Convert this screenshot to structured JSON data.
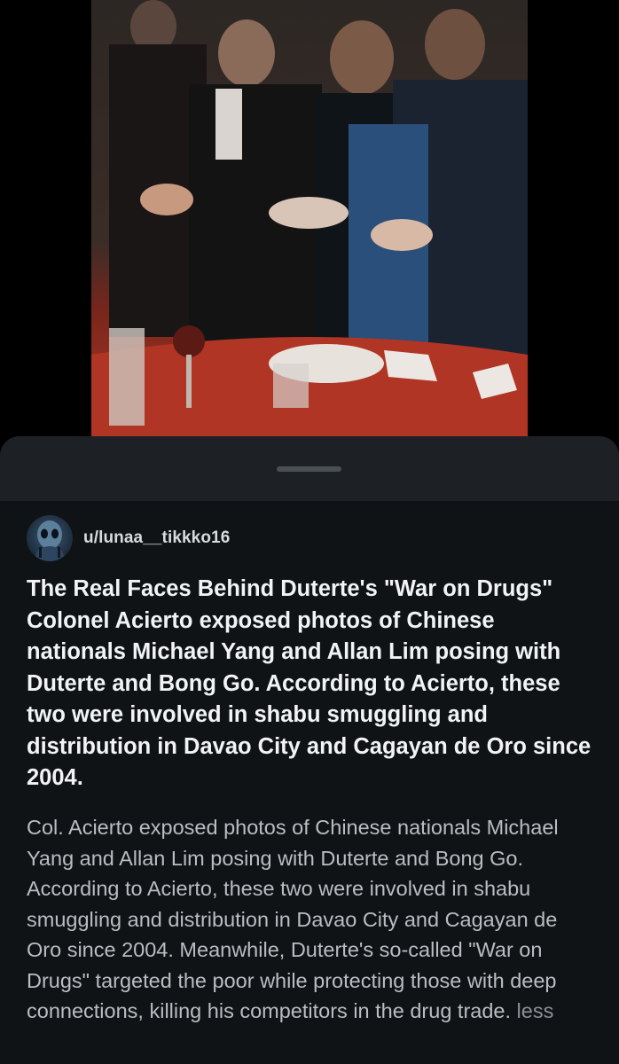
{
  "post": {
    "author": "u/lunaa__tikkko16",
    "avatar_icon": "alien-avatar-icon",
    "title": "The Real Faces Behind Duterte's \"War on Drugs\" Colonel Acierto exposed photos of Chinese nationals Michael Yang and Allan Lim posing with Duterte and Bong Go. According to Acierto, these two were involved in shabu smuggling and distribution in Davao City and Cagayan de Oro since 2004.",
    "body": "Col. Acierto exposed photos of Chinese nationals Michael Yang and Allan Lim posing with Duterte and Bong Go. According to Acierto, these two were involved in shabu smuggling and distribution in Davao City and Cagayan de Oro since 2004. Meanwhile, Duterte's so-called \"War on Drugs\" targeted the poor while protecting those with deep connections, killing his competitors in the drug trade.",
    "less_label": "less"
  },
  "colors": {
    "background": "#000000",
    "sheet": "#0f1315",
    "sheet_header": "#1d2125",
    "title_text": "#f2f3f4",
    "body_text": "#b9bec3",
    "link_text": "#8b9197"
  }
}
